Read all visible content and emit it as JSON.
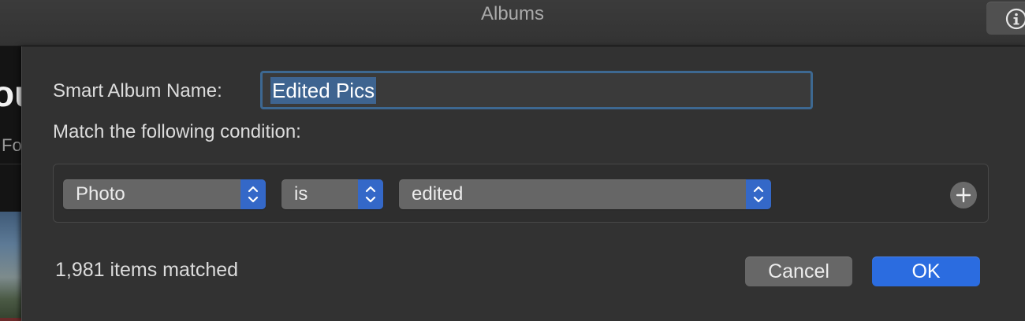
{
  "window": {
    "title": "Albums"
  },
  "background": {
    "heading_fragment": "ou",
    "sub_fragment": "Fo"
  },
  "dialog": {
    "name_label": "Smart Album Name:",
    "name_value": "Edited Pics",
    "condition_label": "Match the following condition:",
    "condition": {
      "field": "Photo",
      "operator": "is",
      "value": "edited"
    },
    "matched_count": "1,981 items matched",
    "cancel_label": "Cancel",
    "ok_label": "OK"
  },
  "icons": {
    "info": "info-icon",
    "add": "plus-icon",
    "popup_arrows": "chevron-up-down-icon"
  },
  "colors": {
    "accent": "#2b6ce0",
    "popup_arrow_bg": "#3468c8",
    "focus_ring": "#3d6891",
    "sheet_bg": "#323232"
  }
}
